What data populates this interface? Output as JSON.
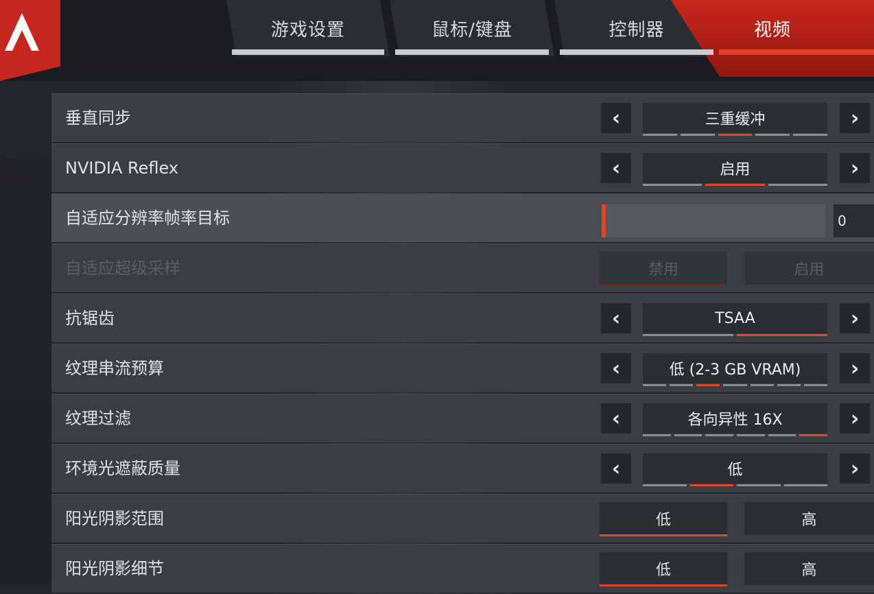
{
  "tabs": [
    {
      "label": "游戏设置"
    },
    {
      "label": "鼠标/键盘"
    },
    {
      "label": "控制器"
    },
    {
      "label": "视频"
    }
  ],
  "accent_color": "#e0452d",
  "settings": {
    "vsync": {
      "label": "垂直同步",
      "value": "三重缓冲",
      "options_count": 5,
      "selected_index": 2
    },
    "reflex": {
      "label": "NVIDIA Reflex",
      "value": "启用",
      "options_count": 3,
      "selected_index": 1
    },
    "adaptive_res": {
      "label": "自适应分辨率帧率目标",
      "value": "0",
      "fill_fraction": 0.0
    },
    "adaptive_ss": {
      "label": "自适应超级采样",
      "opt_a": "禁用",
      "opt_b": "启用",
      "selected": "a",
      "disabled": true
    },
    "aa": {
      "label": "抗锯齿",
      "value": "TSAA",
      "options_count": 2,
      "selected_index": 1
    },
    "texture_budget": {
      "label": "纹理串流预算",
      "value": "低 (2-3 GB VRAM)",
      "options_count": 7,
      "selected_index": 2
    },
    "texture_filter": {
      "label": "纹理过滤",
      "value": "各向异性 16X",
      "options_count": 6,
      "selected_index": 5
    },
    "ao_quality": {
      "label": "环境光遮蔽质量",
      "value": "低",
      "options_count": 4,
      "selected_index": 1
    },
    "sun_shadow_range": {
      "label": "阳光阴影范围",
      "opt_a": "低",
      "opt_b": "高",
      "selected": "a"
    },
    "sun_shadow_detail": {
      "label": "阳光阴影细节",
      "opt_a": "低",
      "opt_b": "高",
      "selected": "a"
    }
  },
  "icons": {
    "left": "chevron-left-icon",
    "right": "chevron-right-icon",
    "logo": "apex-logo"
  }
}
